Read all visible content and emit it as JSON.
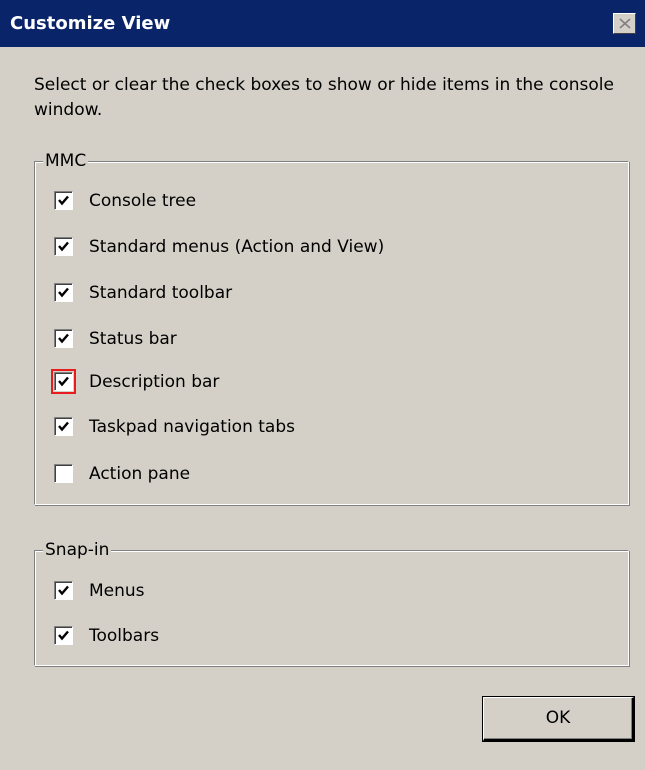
{
  "window": {
    "title": "Customize View",
    "close_icon": "close-icon"
  },
  "intro_text": "Select or clear the check boxes to show or hide items in the console window.",
  "mmc_group": {
    "legend": "MMC",
    "items": [
      {
        "label": "Console tree",
        "checked": true
      },
      {
        "label": "Standard menus (Action and View)",
        "checked": true
      },
      {
        "label": "Standard toolbar",
        "checked": true
      },
      {
        "label": "Status bar",
        "checked": true
      },
      {
        "label": "Description bar",
        "checked": true,
        "highlighted": true
      },
      {
        "label": "Taskpad navigation tabs",
        "checked": true
      },
      {
        "label": "Action pane",
        "checked": false
      }
    ]
  },
  "snapin_group": {
    "legend": "Snap-in",
    "items": [
      {
        "label": "Menus",
        "checked": true
      },
      {
        "label": "Toolbars",
        "checked": true
      }
    ]
  },
  "buttons": {
    "ok_label": "OK"
  },
  "colors": {
    "title_bar": "#0a246a",
    "dialog_background": "#d4d0c8",
    "highlight_outline": "#e81c1c"
  }
}
